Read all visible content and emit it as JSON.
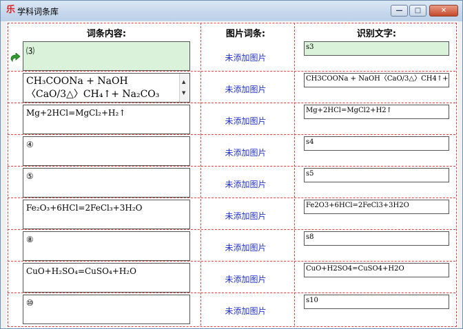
{
  "window": {
    "title": "学科词条库",
    "icon_glyph": "乐",
    "controls": {
      "minimize": "—",
      "maximize": "□",
      "close": "✕"
    }
  },
  "columns": {
    "content": "词条内容:",
    "image": "图片词条:",
    "recognized": "识别文字:"
  },
  "rows": [
    {
      "content": "⑶",
      "image": "未添加图片",
      "recognized": "s3",
      "selected": true
    },
    {
      "content": "CH₃COONa + NaOH〈CaO/3△〉CH₄↑+ Na₂CO₃",
      "image": "未添加图片",
      "recognized": "CH3COONa + NaOH〈CaO/3△〉CH4↑+"
    },
    {
      "content": "Mg+2HCl=MgCl₂+H₂↑",
      "image": "未添加图片",
      "recognized": "Mg+2HCl=MgCl2+H2↑"
    },
    {
      "content": "④",
      "image": "未添加图片",
      "recognized": "s4"
    },
    {
      "content": "⑤",
      "image": "未添加图片",
      "recognized": "s5"
    },
    {
      "content": "Fe₂O₃+6HCl=2FeCl₃+3H₂O",
      "image": "未添加图片",
      "recognized": "Fe2O3+6HCl=2FeCl3+3H2O"
    },
    {
      "content": "⑧",
      "image": "未添加图片",
      "recognized": "s8"
    },
    {
      "content": "CuO+H₂SO₄=CuSO₄+H₂O",
      "image": "未添加图片",
      "recognized": "CuO+H2SO4=CuSO4+H2O"
    },
    {
      "content": "⑩",
      "image": "未添加图片",
      "recognized": "s10"
    }
  ],
  "icons": {
    "current_row_marker": "green-arrow-icon",
    "scroll_up": "▲",
    "scroll_down": "▼"
  },
  "colors": {
    "selected_bg": "#d9f2d9",
    "grid_dash": "#e04040",
    "link": "#2233cc"
  }
}
